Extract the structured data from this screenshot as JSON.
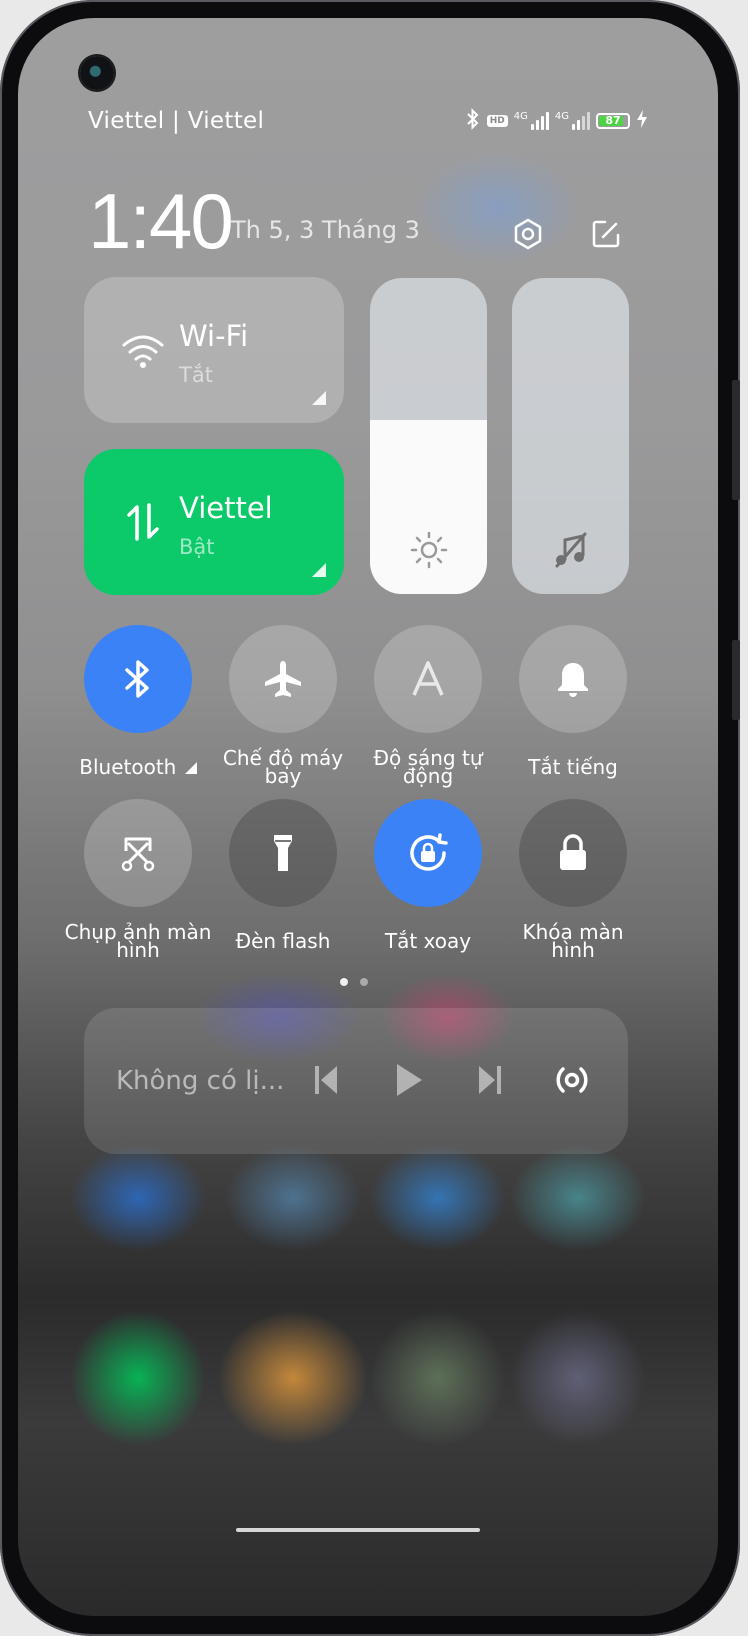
{
  "status_bar": {
    "carrier": "Viettel | Viettel",
    "hd_badge": "HD",
    "sim1_network": "4G",
    "sim2_network": "4G",
    "battery_percent": "87",
    "battery_level": 0.87,
    "icons": [
      "bluetooth-icon",
      "hd-icon",
      "signal-icon",
      "signal-icon",
      "battery-icon",
      "charging-icon"
    ]
  },
  "header": {
    "time": "1:40",
    "date": "Th 5, 3 Tháng 3",
    "settings_icon": "settings-icon",
    "edit_icon": "edit-icon"
  },
  "tiles": {
    "wifi": {
      "name": "Wi-Fi",
      "status": "Tắt",
      "icon": "wifi-icon"
    },
    "mobile_data": {
      "name": "Viettel",
      "status": "Bật",
      "icon": "data-transfer-icon",
      "color": "#0cc96a"
    }
  },
  "sliders": {
    "brightness": {
      "level": 0.55,
      "icon": "sun-icon"
    },
    "volume": {
      "level": 0.0,
      "icon": "music-muted-icon"
    }
  },
  "toggles": [
    {
      "label": "Bluetooth",
      "on": true,
      "icon": "bluetooth-icon"
    },
    {
      "label": "Chế độ máy bay",
      "on": false,
      "icon": "airplane-icon"
    },
    {
      "label": "Độ sáng tự động",
      "on": false,
      "icon": "auto-brightness-icon"
    },
    {
      "label": "Tắt tiếng",
      "on": false,
      "icon": "bell-icon"
    },
    {
      "label": "Chụp ảnh màn hình",
      "on": false,
      "icon": "screenshot-icon"
    },
    {
      "label": "Đèn flash",
      "on": false,
      "icon": "flashlight-icon"
    },
    {
      "label": "Tắt xoay",
      "on": true,
      "icon": "rotation-lock-icon"
    },
    {
      "label": "Khóa màn hình",
      "on": false,
      "icon": "lock-icon"
    }
  ],
  "pager": {
    "pages": 2,
    "current": 1
  },
  "media": {
    "title": "Không có lị...",
    "controls": [
      "previous-icon",
      "play-icon",
      "next-icon",
      "cast-icon"
    ]
  },
  "colors": {
    "accent": "#3b82f6",
    "data_on": "#0cc96a",
    "battery": "#4cd442"
  }
}
